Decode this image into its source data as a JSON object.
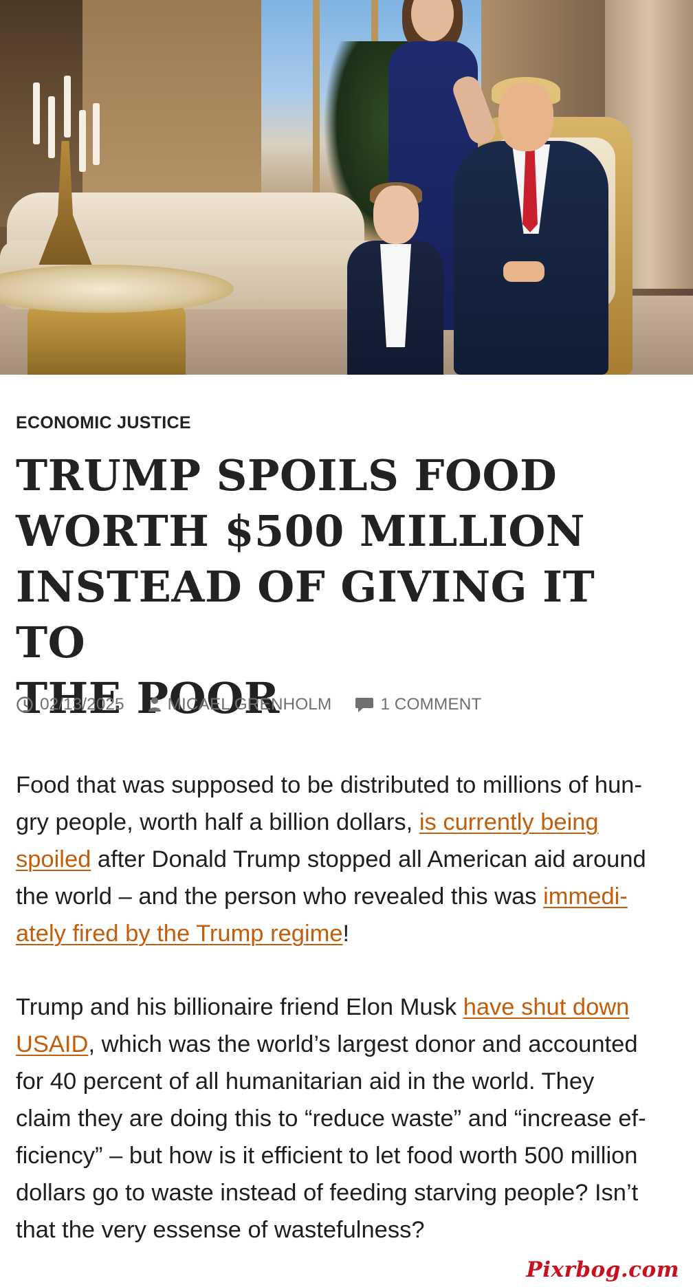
{
  "hero_image": {
    "alt": "Photo of Trump family in gilded apartment",
    "icon": "hero-photo"
  },
  "category": "ECONOMIC JUSTICE",
  "title": "TRUMP SPOILS FOOD WORTH $500 MILLION INSTEAD OF GIVING IT TO THE POOR",
  "title_lines": [
    "TRUMP SPOILS FOOD",
    "WORTH $500 MILLION",
    "INSTEAD OF GIVING IT TO",
    "THE POOR"
  ],
  "meta": {
    "date": "02/13/2025",
    "author": "MICAEL GRENHOLM",
    "comments": "1 COMMENT",
    "icons": {
      "date": "clock-icon",
      "author": "person-icon",
      "comments": "comment-bubble-icon"
    },
    "color": "#707070"
  },
  "paragraph1": {
    "line1": "Food that was supposed to be distributed to millions of hun-",
    "line2_text": "gry people, worth half a billion dollars, ",
    "link1_part1": "is currently being",
    "link1_part2": "spoiled",
    "line3_text": " after Donald Trump stopped all American aid around",
    "line4_text": "the world – and the person who revealed this was ",
    "link2_part1": "immedi-",
    "link2_part2": "ately fired by the Trump regime",
    "line5_text": "!"
  },
  "paragraph2": {
    "line1_text": "Trump and his billionaire friend Elon Musk ",
    "link_part1": "have shut down",
    "link_part2": "USAID",
    "line2_text": ", which was the world’s largest donor and accounted",
    "line3": "for 40 percent of all humanitarian aid in the world. They",
    "line4": "claim they are doing this to “reduce waste” and “increase ef-",
    "line5": "ficiency” – but how is it efficient to let food worth 500 million",
    "line6": "dollars go to waste instead of feeding starving people? Isn’t",
    "line7": "that the very essense of wastefulness?"
  },
  "watermark": "Pixrbog.com",
  "colors": {
    "link": "#c25d0c",
    "title": "#222222",
    "watermark": "#c9101c"
  }
}
